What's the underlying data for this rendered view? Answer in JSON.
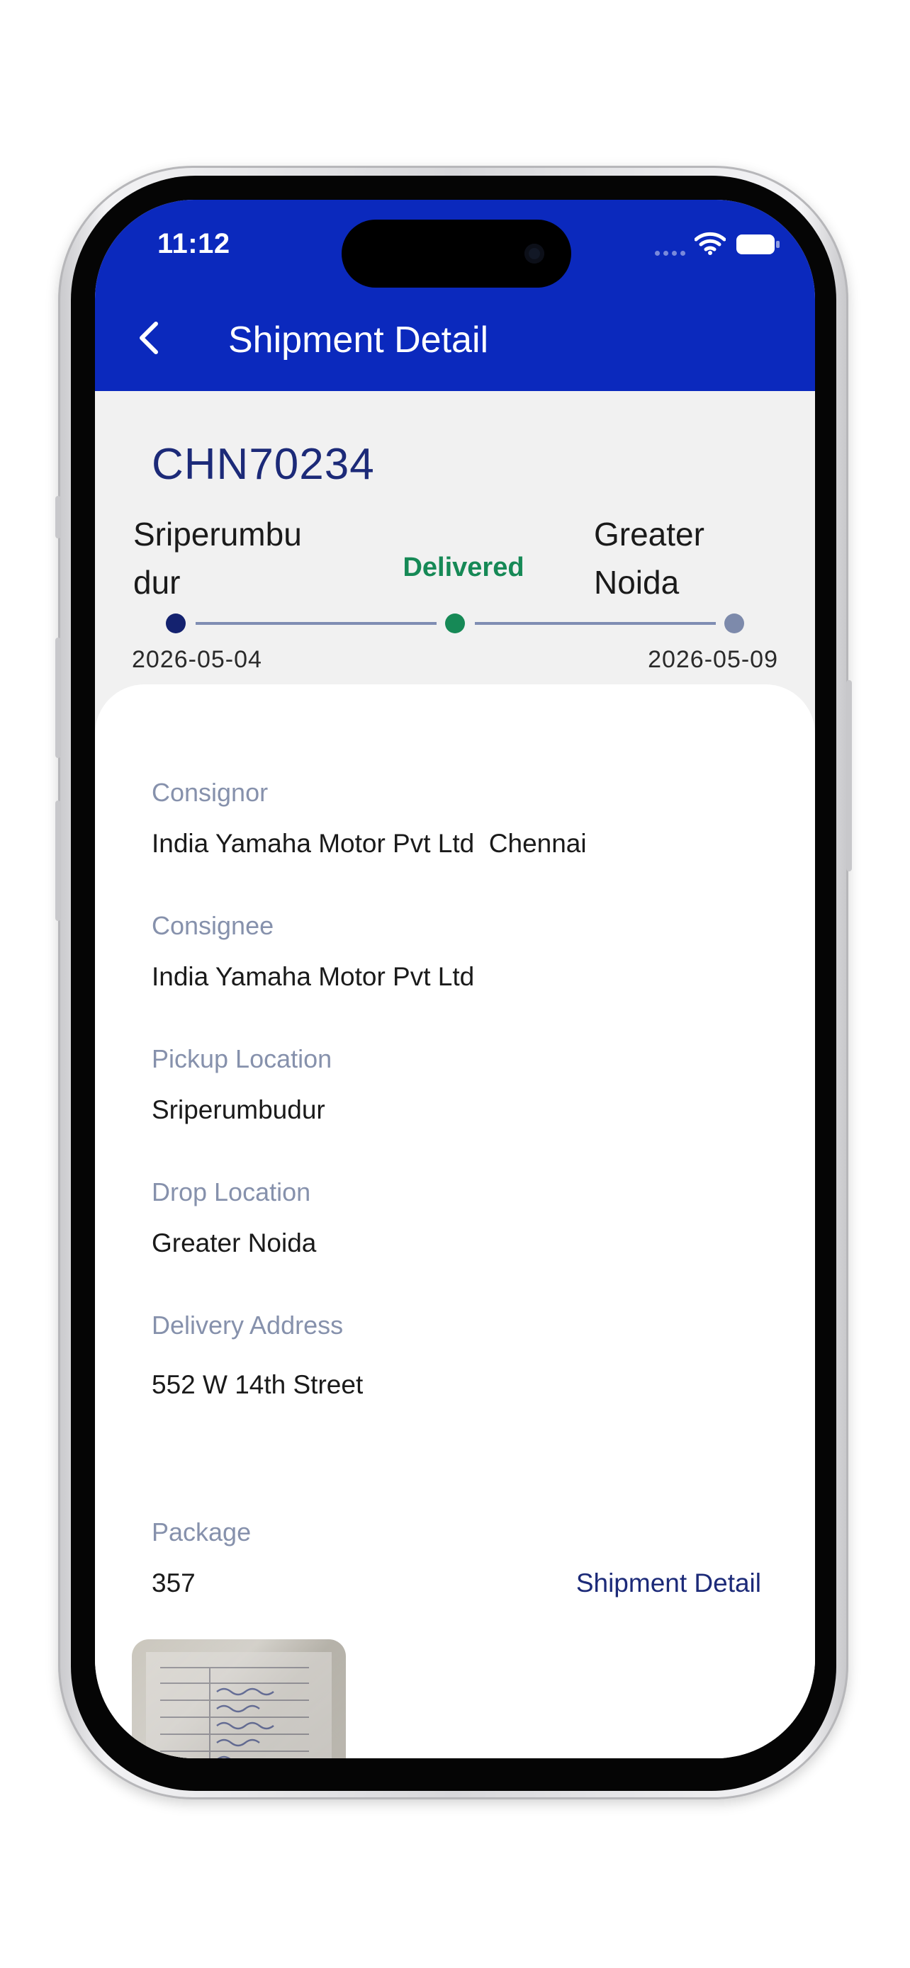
{
  "status_bar": {
    "time": "11:12"
  },
  "header": {
    "title": "Shipment Detail"
  },
  "shipment": {
    "id": "CHN70234",
    "origin": "Sriperumbudur",
    "destination": "Greater Noida",
    "status": "Delivered",
    "origin_date": "2026-05-04",
    "destination_date": "2026-05-09"
  },
  "details": {
    "consignor_label": "Consignor",
    "consignor_value": "India Yamaha Motor Pvt Ltd  Chennai",
    "consignee_label": "Consignee",
    "consignee_value": "India Yamaha Motor Pvt Ltd",
    "pickup_label": "Pickup Location",
    "pickup_value": "Sriperumbudur",
    "drop_label": "Drop Location",
    "drop_value": "Greater Noida",
    "address_label": "Delivery Address",
    "address_value": "552 W 14th Street",
    "package_label": "Package",
    "package_value": "357",
    "shipment_detail_link": "Shipment Detail"
  },
  "colors": {
    "header_bg": "#0b29bd",
    "accent": "#1c2a78",
    "delivered": "#168956",
    "label": "#8691ac"
  },
  "icons": [
    "back-chevron-icon",
    "wifi-icon",
    "battery-icon",
    "signal-icon"
  ]
}
